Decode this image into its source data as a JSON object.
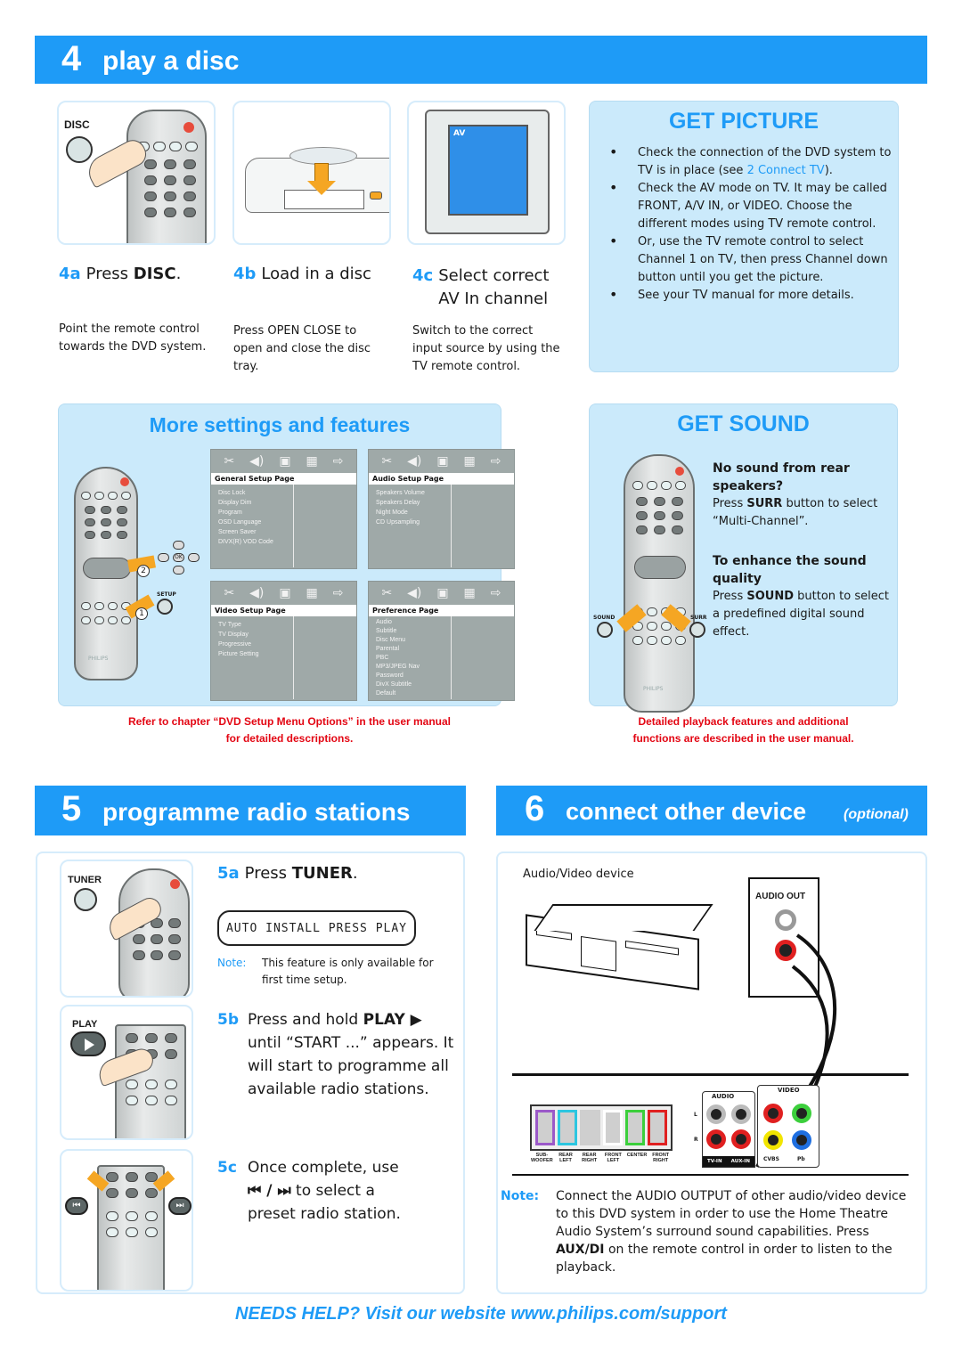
{
  "section4": {
    "number": "4",
    "title": "play a disc",
    "illustrations": {
      "disc_button_label": "DISC",
      "tv_screen_label": "AV"
    },
    "steps": [
      {
        "label": "4a",
        "title_prefix": "Press ",
        "title_bold": "DISC",
        "title_suffix": ".",
        "description": "Point the remote control towards the DVD system."
      },
      {
        "label": "4b",
        "title_prefix": "Load in a disc",
        "title_bold": "",
        "title_suffix": "",
        "description": "Press OPEN CLOSE to open and close the disc tray."
      },
      {
        "label": "4c",
        "title_prefix": "Select correct AV In channel",
        "title_bold": "",
        "title_suffix": "",
        "description": "Switch to the correct input source by using the TV remote control."
      }
    ],
    "get_picture": {
      "heading": "GET PICTURE",
      "bullets": [
        {
          "pre": "Check the connection of the DVD system to TV is in place (see ",
          "link": "2 Connect TV",
          "post": ")."
        },
        {
          "pre": "Check the AV mode on TV.  It may be called FRONT, A/V IN, or VIDEO.  Choose the different modes using TV remote control.",
          "link": "",
          "post": ""
        },
        {
          "pre": "Or, use the TV remote control to select Channel 1 on TV, then press Channel down button until you get the picture.",
          "link": "",
          "post": ""
        },
        {
          "pre": "See your TV manual for more details.",
          "link": "",
          "post": ""
        }
      ]
    },
    "more_settings": {
      "heading": "More settings and features",
      "setup_button_label": "SETUP",
      "callouts": [
        "1",
        "2"
      ],
      "nav_ok_label": "OK",
      "menus": [
        {
          "title": "General Setup Page",
          "items": [
            "Disc Lock",
            "Display Dim",
            "Program",
            "OSD Language",
            "Screen Saver",
            "DIVX(R) VOD Code"
          ]
        },
        {
          "title": "Audio Setup Page",
          "items": [
            "Speakers Volume",
            "Speakers Delay",
            "Night Mode",
            "CD Upsampling"
          ]
        },
        {
          "title": "Video Setup Page",
          "items": [
            "TV Type",
            "TV Display",
            "Progressive",
            "Picture Setting"
          ]
        },
        {
          "title": "Preference Page",
          "items": [
            "Audio",
            "Subtitle",
            "Disc Menu",
            "Parental",
            "PBC",
            "MP3/JPEG Nav",
            "Password",
            "DivX Subtitle",
            "Default"
          ]
        }
      ],
      "footnote_line1": "Refer to chapter “DVD Setup Menu Options” in the user manual",
      "footnote_line2": "for detailed descriptions.",
      "remote_brand": "PHILIPS"
    },
    "get_sound": {
      "heading": "GET SOUND",
      "sound_button_label": "SOUND",
      "surr_button_label": "SURR",
      "tips": [
        {
          "title": "No sound from rear speakers?",
          "text_pre": "Press ",
          "text_bold": "SURR",
          "text_post": " button to select “Multi-Channel”."
        },
        {
          "title": "To enhance the sound quality",
          "text_pre": "Press ",
          "text_bold": "SOUND",
          "text_post": " button to select a predefined digital sound effect."
        }
      ],
      "footnote_line1": "Detailed playback features and additional",
      "footnote_line2": "functions are described in the user manual."
    }
  },
  "section5": {
    "number": "5",
    "title": "programme radio stations",
    "tuner_button_label": "TUNER",
    "play_button_label": "PLAY",
    "step_5a": {
      "label": "5a",
      "prefix": "Press ",
      "bold": "TUNER",
      "suffix": "."
    },
    "lcd_display": "AUTO INSTALL PRESS PLAY",
    "note_label": "Note:",
    "note_text": "This feature is only available for first time setup.",
    "step_5b": {
      "label": "5b",
      "prefix": "Press and hold ",
      "bold": "PLAY ▶",
      "rest": "until “START ...” appears. It will start to programme all available radio stations."
    },
    "step_5c": {
      "label": "5c",
      "line1": "Once complete, use",
      "controls": "⏮ / ⏭",
      "line2": " to select a",
      "line3": "preset radio station."
    }
  },
  "section6": {
    "number": "6",
    "title": "connect other device",
    "title_suffix": "(optional)",
    "device_label": "Audio/Video device",
    "audio_out_label": "AUDIO OUT",
    "speaker_labels": [
      "SUB-WOOFER",
      "REAR LEFT",
      "REAR RIGHT",
      "FRONT LEFT",
      "CENTER",
      "FRONT RIGHT"
    ],
    "speaker_colors": [
      "#9b59c9",
      "#2cc6e0",
      "#cfcfcf",
      "#ffffff",
      "#3ccf3c",
      "#e02020"
    ],
    "audio_panel_label": "AUDIO",
    "video_panel_label": "VIDEO",
    "jack_labels": {
      "l": "L",
      "r": "R",
      "tv_in": "TV-IN",
      "aux_in": "AUX-IN",
      "cvbs": "CVBS",
      "pb": "Pb"
    },
    "note_label": "Note:",
    "note_text_pre": "Connect the AUDIO OUTPUT of other audio/video device to this DVD system in order to use the Home Theatre Audio System’s surround sound capabilities. Press ",
    "note_bold": "AUX/DI",
    "note_text_post": " on the remote control in order to listen to the playback."
  },
  "footer": {
    "help_text": "NEEDS HELP? Visit our website www.philips.com/support"
  },
  "colors": {
    "brand_blue": "#1e9bf7",
    "light_blue_panel": "#cbeafb",
    "accent_red": "#e30613",
    "arrow_orange": "#f5a623"
  }
}
